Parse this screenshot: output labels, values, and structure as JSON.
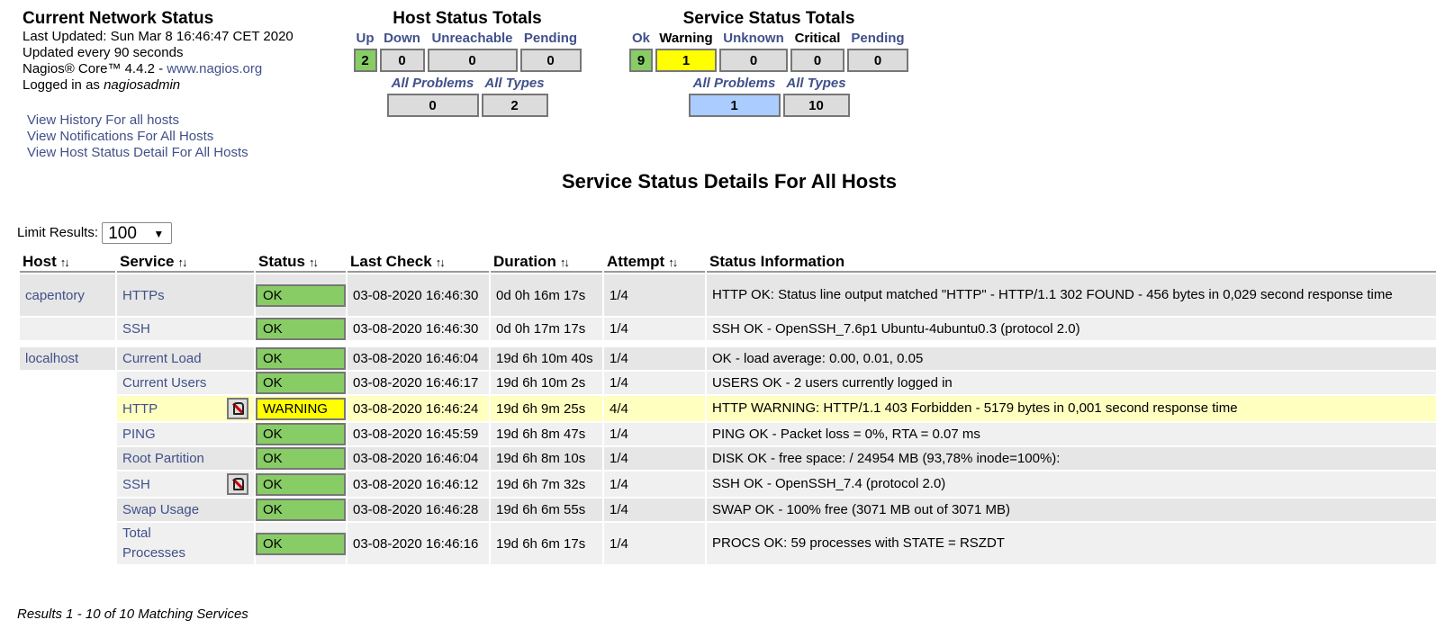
{
  "info": {
    "title": "Current Network Status",
    "last_updated": "Last Updated: Sun Mar 8 16:46:47 CET 2020",
    "update_interval": "Updated every 90 seconds",
    "version_prefix": "Nagios® Core™ 4.4.2 - ",
    "version_link": "www.nagios.org",
    "logged_in_prefix": "Logged in as ",
    "username": "nagiosadmin"
  },
  "links": [
    "View History For all hosts",
    "View Notifications For All Hosts",
    "View Host Status Detail For All Hosts"
  ],
  "host_totals": {
    "title": "Host Status Totals",
    "labels": {
      "up": "Up",
      "down": "Down",
      "unreachable": "Unreachable",
      "pending": "Pending"
    },
    "values": {
      "up": "2",
      "down": "0",
      "unreachable": "0",
      "pending": "0"
    },
    "problems_label": "All Problems",
    "types_label": "All Types",
    "problems": "0",
    "types": "2"
  },
  "service_totals": {
    "title": "Service Status Totals",
    "labels": {
      "ok": "Ok",
      "warning": "Warning",
      "unknown": "Unknown",
      "critical": "Critical",
      "pending": "Pending"
    },
    "values": {
      "ok": "9",
      "warning": "1",
      "unknown": "0",
      "critical": "0",
      "pending": "0"
    },
    "problems_label": "All Problems",
    "types_label": "All Types",
    "problems": "1",
    "types": "10"
  },
  "page_title": "Service Status Details For All Hosts",
  "limit": {
    "label": "Limit Results:",
    "value": "100",
    "arrow": "▼"
  },
  "columns": {
    "host": "Host",
    "service": "Service",
    "status": "Status",
    "last_check": "Last Check",
    "duration": "Duration",
    "attempt": "Attempt",
    "info": "Status Information",
    "sort_glyph": "↑↓"
  },
  "rows": [
    {
      "host": "capentory",
      "service": "HTTPs",
      "status": "OK",
      "last_check": "03-08-2020 16:46:30",
      "duration": "0d 0h 16m 17s",
      "attempt": "1/4",
      "info": "HTTP OK: Status line output matched \"HTTP\" - HTTP/1.1 302 FOUND - 456 bytes in 0,029 second response time"
    },
    {
      "host": "",
      "service": "SSH",
      "status": "OK",
      "last_check": "03-08-2020 16:46:30",
      "duration": "0d 0h 17m 17s",
      "attempt": "1/4",
      "info": "SSH OK - OpenSSH_7.6p1 Ubuntu-4ubuntu0.3 (protocol 2.0)"
    },
    {
      "host": "localhost",
      "service": "Current Load",
      "status": "OK",
      "last_check": "03-08-2020 16:46:04",
      "duration": "19d 6h 10m 40s",
      "attempt": "1/4",
      "info": "OK - load average: 0.00, 0.01, 0.05"
    },
    {
      "host": "",
      "service": "Current Users",
      "status": "OK",
      "last_check": "03-08-2020 16:46:17",
      "duration": "19d 6h 10m 2s",
      "attempt": "1/4",
      "info": "USERS OK - 2 users currently logged in"
    },
    {
      "host": "",
      "service": "HTTP",
      "status": "WARNING",
      "last_check": "03-08-2020 16:46:24",
      "duration": "19d 6h 9m 25s",
      "attempt": "4/4",
      "info": "HTTP WARNING: HTTP/1.1 403 Forbidden - 5179 bytes in 0,001 second response time"
    },
    {
      "host": "",
      "service": "PING",
      "status": "OK",
      "last_check": "03-08-2020 16:45:59",
      "duration": "19d 6h 8m 47s",
      "attempt": "1/4",
      "info": "PING OK - Packet loss = 0%, RTA = 0.07 ms"
    },
    {
      "host": "",
      "service": "Root Partition",
      "status": "OK",
      "last_check": "03-08-2020 16:46:04",
      "duration": "19d 6h 8m 10s",
      "attempt": "1/4",
      "info": "DISK OK - free space: / 24954 MB (93,78% inode=100%):"
    },
    {
      "host": "",
      "service": "SSH",
      "status": "OK",
      "last_check": "03-08-2020 16:46:12",
      "duration": "19d 6h 7m 32s",
      "attempt": "1/4",
      "info": "SSH OK - OpenSSH_7.4 (protocol 2.0)"
    },
    {
      "host": "",
      "service": "Swap Usage",
      "status": "OK",
      "last_check": "03-08-2020 16:46:28",
      "duration": "19d 6h 6m 55s",
      "attempt": "1/4",
      "info": "SWAP OK - 100% free (3071 MB out of 3071 MB)"
    },
    {
      "host": "",
      "service": "Total Processes",
      "status": "OK",
      "last_check": "03-08-2020 16:46:16",
      "duration": "19d 6h 6m 17s",
      "attempt": "1/4",
      "info": "PROCS OK: 59 processes with STATE = RSZDT"
    }
  ],
  "results_text": "Results 1 - 10 of 10 Matching Services",
  "colors": {
    "ok": "#88cc66",
    "warning": "#ffff00",
    "link": "#40508a",
    "selected": "#aaccff"
  },
  "icons": {
    "notifications_disabled": "notifications-disabled-icon"
  }
}
